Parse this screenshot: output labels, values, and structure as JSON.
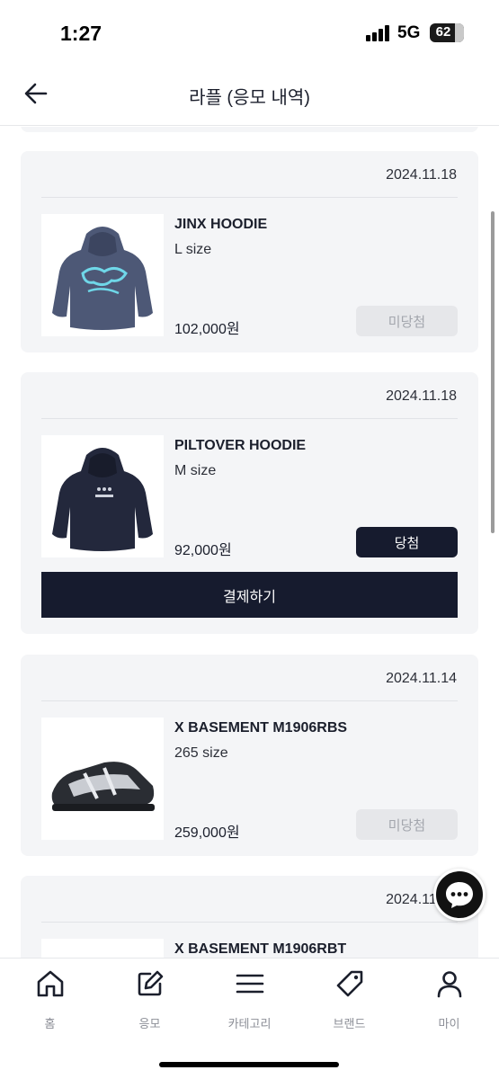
{
  "status_bar": {
    "time": "1:27",
    "network": "5G",
    "battery": "62"
  },
  "header": {
    "title": "라플 (응모 내역)"
  },
  "entries": [
    {
      "date": "2024.11.18",
      "name": "JINX HOODIE",
      "size": "L size",
      "price": "102,000원",
      "status": "미당첨"
    },
    {
      "date": "2024.11.18",
      "name": "PILTOVER HOODIE",
      "size": "M size",
      "price": "92,000원",
      "status": "당첨",
      "pay_label": "결제하기"
    },
    {
      "date": "2024.11.14",
      "name": "X BASEMENT M1906RBS",
      "size": "265 size",
      "price": "259,000원",
      "status": "미당첨"
    },
    {
      "date": "2024.11.14",
      "name": "X BASEMENT M1906RBT"
    }
  ],
  "bottom_nav": [
    {
      "label": "홈",
      "icon": "home-icon"
    },
    {
      "label": "응모",
      "icon": "edit-icon"
    },
    {
      "label": "카테고리",
      "icon": "menu-icon"
    },
    {
      "label": "브랜드",
      "icon": "tag-icon"
    },
    {
      "label": "마이",
      "icon": "user-icon"
    }
  ],
  "colors": {
    "accent": "#161b2e",
    "card_bg": "#f4f5f7",
    "lost_btn_bg": "#e6e7ea",
    "lost_btn_text": "#a3a6ad"
  }
}
